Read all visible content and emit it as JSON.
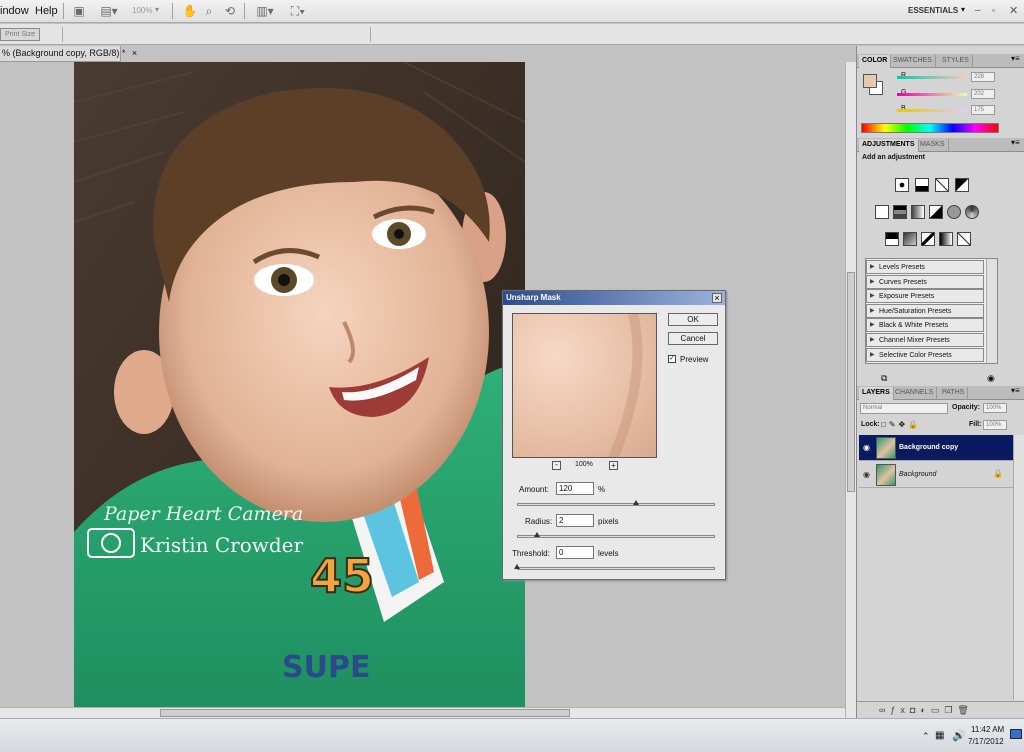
{
  "menubar": {
    "items": [
      "indow",
      "Help"
    ],
    "zoom": "100%",
    "workspace": "ESSENTIALS"
  },
  "options_bar": {
    "print_size_button": "Print Size"
  },
  "document": {
    "tab_title": "% (Background copy, RGB/8) *",
    "tab_close": "×",
    "watermark_line1": "Paper Heart Camera",
    "watermark_line2": "Kristin Crowder",
    "shirt_number": "45",
    "shirt_text": "SUPE"
  },
  "color_panel": {
    "tabs": [
      "COLOR",
      "SWATCHES",
      "STYLES"
    ],
    "channels": [
      {
        "label": "R",
        "value": "228"
      },
      {
        "label": "G",
        "value": "202"
      },
      {
        "label": "B",
        "value": "175"
      }
    ],
    "foreground": "#e4caaf"
  },
  "adjustments_panel": {
    "tabs": [
      "ADJUSTMENTS",
      "MASKS"
    ],
    "heading": "Add an adjustment",
    "presets": [
      "Levels Presets",
      "Curves Presets",
      "Exposure Presets",
      "Hue/Saturation Presets",
      "Black & White Presets",
      "Channel Mixer Presets",
      "Selective Color Presets"
    ]
  },
  "layers_panel": {
    "tabs": [
      "LAYERS",
      "CHANNELS",
      "PATHS"
    ],
    "blend_mode": "Normal",
    "opacity_label": "Opacity:",
    "opacity_value": "100%",
    "lock_label": "Lock:",
    "fill_label": "Fill:",
    "fill_value": "100%",
    "layers": [
      {
        "name": "Background copy",
        "selected": true
      },
      {
        "name": "Background",
        "selected": false
      }
    ]
  },
  "dialog": {
    "title": "Unsharp Mask",
    "ok": "OK",
    "cancel": "Cancel",
    "preview_label": "Preview",
    "preview_checked": true,
    "zoom": "100%",
    "zoom_out": "-",
    "zoom_in": "+",
    "amount_label": "Amount:",
    "amount_value": "120",
    "amount_unit": "%",
    "amount_slider": 0.6,
    "radius_label": "Radius:",
    "radius_value": "2",
    "radius_unit": "pixels",
    "radius_slider": 0.1,
    "threshold_label": "Threshold:",
    "threshold_value": "0",
    "threshold_unit": "levels",
    "threshold_slider": 0.0
  },
  "taskbar": {
    "time": "11:42 AM",
    "date": "7/17/2012"
  }
}
